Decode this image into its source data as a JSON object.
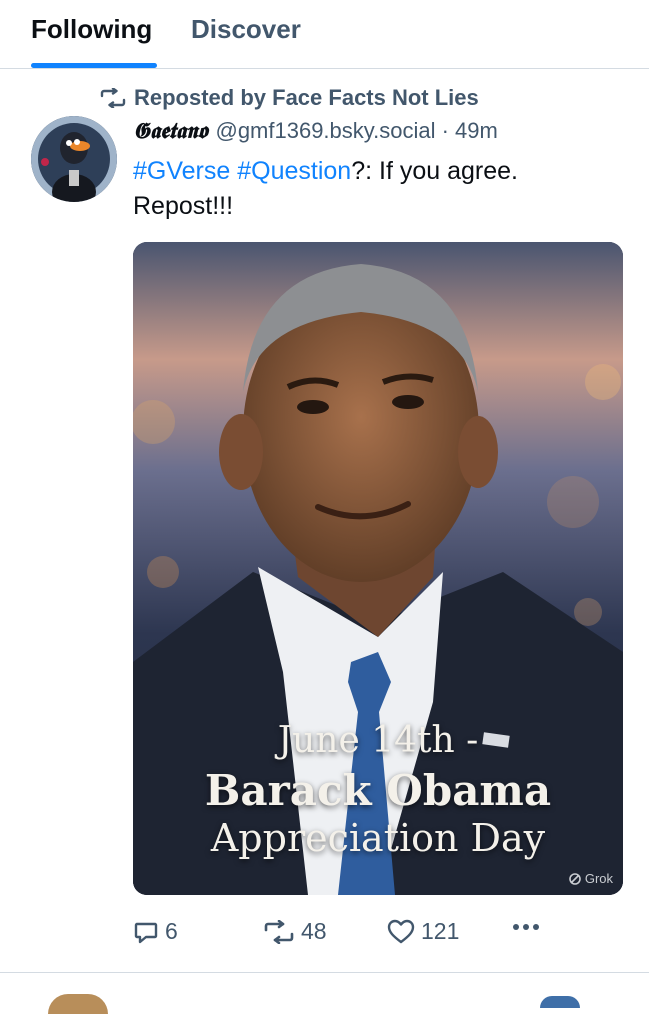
{
  "tabs": [
    {
      "label": "Following",
      "active": true
    },
    {
      "label": "Discover",
      "active": false
    }
  ],
  "post": {
    "repost_label": "Reposted by Face Facts Not Lies",
    "author": {
      "display_name": "𝕲𝖆𝖊𝖙𝖆𝖓𝖔",
      "handle_time": "@gmf1369.bsky.social · 49m"
    },
    "text": {
      "hashtag1": "#GVerse",
      "space": " ",
      "hashtag2": "#Question",
      "rest": "?: If you agree. Repost!!!"
    },
    "image": {
      "line1": "June 14th -",
      "line2": "Barack Obama",
      "line3": "Appreciation Day",
      "watermark": "Grok"
    },
    "actions": {
      "replies": "6",
      "reposts": "48",
      "likes": "121"
    }
  },
  "colors": {
    "accent": "#1083fe",
    "muted": "#42576c",
    "text": "#0b0f14",
    "divider": "#d4dbe2"
  },
  "icons": [
    "repost-icon",
    "reply-icon",
    "like-icon",
    "more-icon",
    "grok-icon"
  ]
}
